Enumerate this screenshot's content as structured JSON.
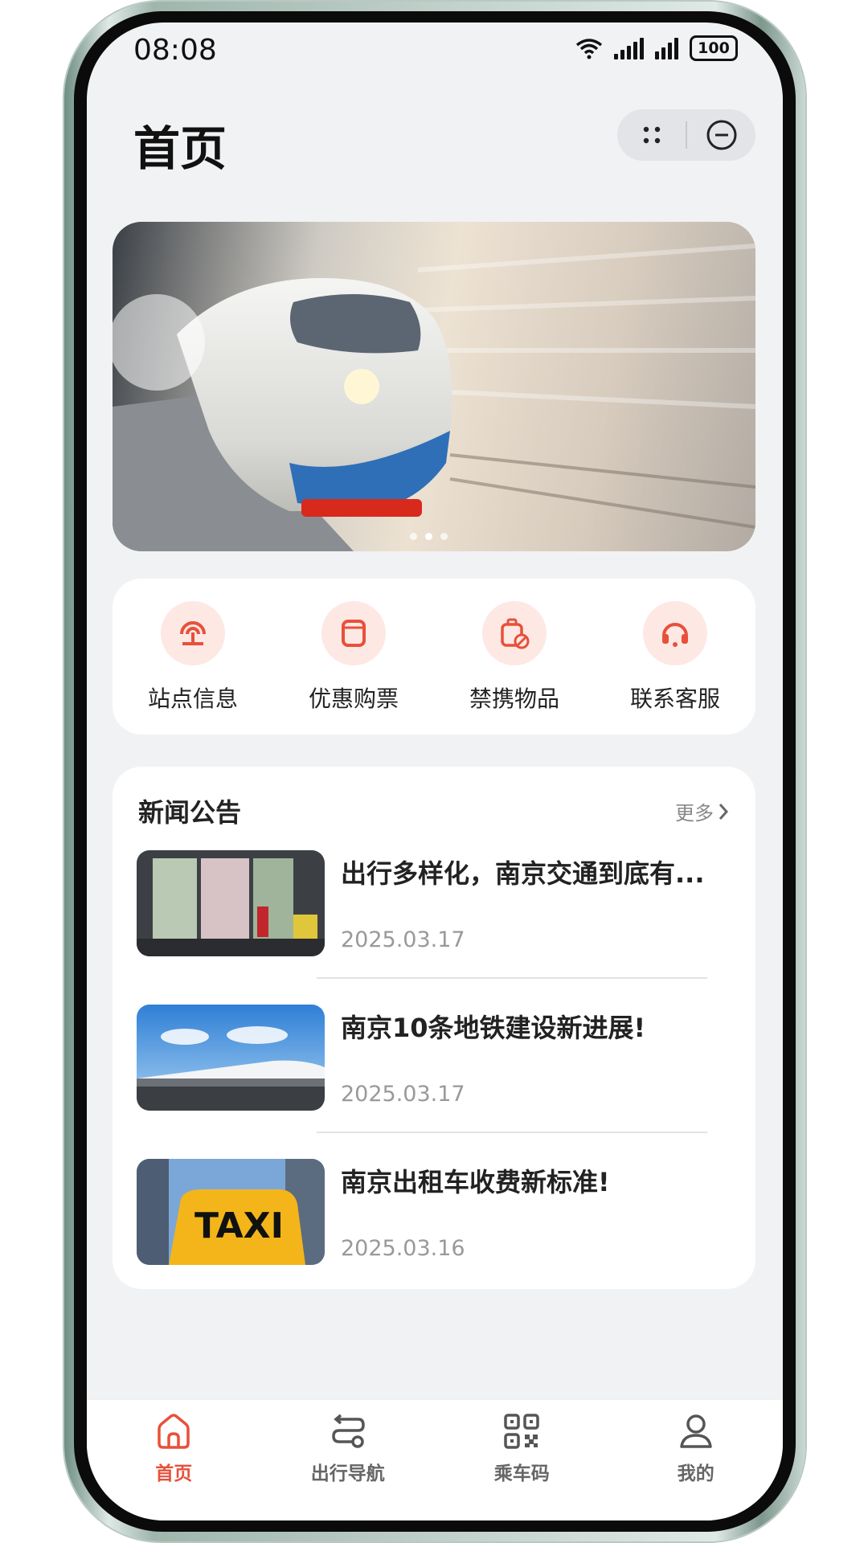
{
  "status_bar": {
    "time": "08:08",
    "battery": "100"
  },
  "header": {
    "title": "首页"
  },
  "banner": {
    "dots": 3,
    "active_index": 1
  },
  "quick_menu": [
    {
      "label": "站点信息",
      "icon": "station-icon"
    },
    {
      "label": "优惠购票",
      "icon": "ticket-icon"
    },
    {
      "label": "禁携物品",
      "icon": "prohibited-luggage-icon"
    },
    {
      "label": "联系客服",
      "icon": "headset-icon"
    }
  ],
  "news": {
    "title": "新闻公告",
    "more_label": "更多",
    "items": [
      {
        "headline": "出行多样化，南京交通到底有...",
        "date": "2025.03.17"
      },
      {
        "headline": "南京10条地铁建设新进展!",
        "date": "2025.03.17"
      },
      {
        "headline": "南京出租车收费新标准!",
        "date": "2025.03.16",
        "thumb_text": "TAXI"
      }
    ]
  },
  "tabbar": {
    "items": [
      {
        "label": "首页",
        "icon": "home-icon",
        "active": true
      },
      {
        "label": "出行导航",
        "icon": "route-icon",
        "active": false
      },
      {
        "label": "乘车码",
        "icon": "qrcode-icon",
        "active": false
      },
      {
        "label": "我的",
        "icon": "user-icon",
        "active": false
      }
    ]
  },
  "colors": {
    "accent": "#e8503a",
    "accent_light": "#fde8e4",
    "background": "#f1f2f4"
  }
}
